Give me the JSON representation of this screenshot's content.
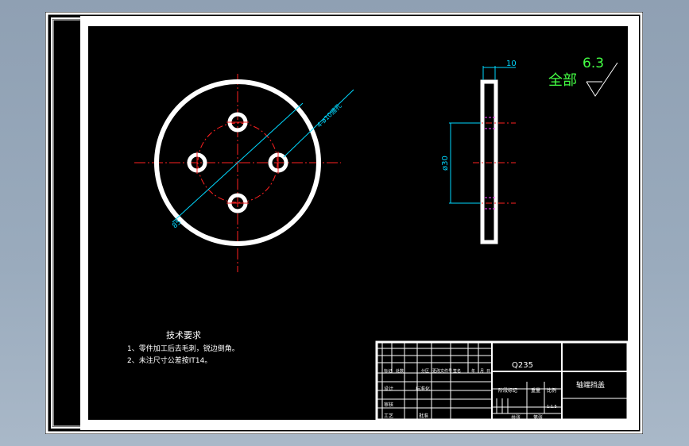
{
  "drawing": {
    "material": "Q235",
    "part_name": "轴端挡盖",
    "roughness": {
      "prefix": "全部",
      "value": "6.3"
    },
    "dimensions": {
      "holes": "4-ø10通孔",
      "outer_diameter": "85",
      "pitch_diameter": "ø30",
      "thickness": "10"
    },
    "tech_requirements": {
      "title": "技术要求",
      "items": [
        "1、零件加工后去毛刺，锐边倒角。",
        "2、未注尺寸公差按IT14。"
      ]
    },
    "title_block": {
      "row_labels": [
        "标记",
        "处数",
        "分区",
        "更改文件号",
        "签名",
        "年",
        "月",
        "日"
      ],
      "design": "设计",
      "standardization": "标准化",
      "review": "审核",
      "process": "工艺",
      "approve": "批准",
      "stage_mark": "阶段标记",
      "weight": "重量",
      "scale_label": "比例",
      "scale": "1:1.5",
      "sheets_total": "共张",
      "sheet_no": "第张"
    },
    "colors": {
      "outline": "#ffffff",
      "center_line": "#ff2020",
      "dimension": "#00d8ff",
      "roughness": "#44ff44",
      "hidden_line": "#ff40ff"
    }
  }
}
